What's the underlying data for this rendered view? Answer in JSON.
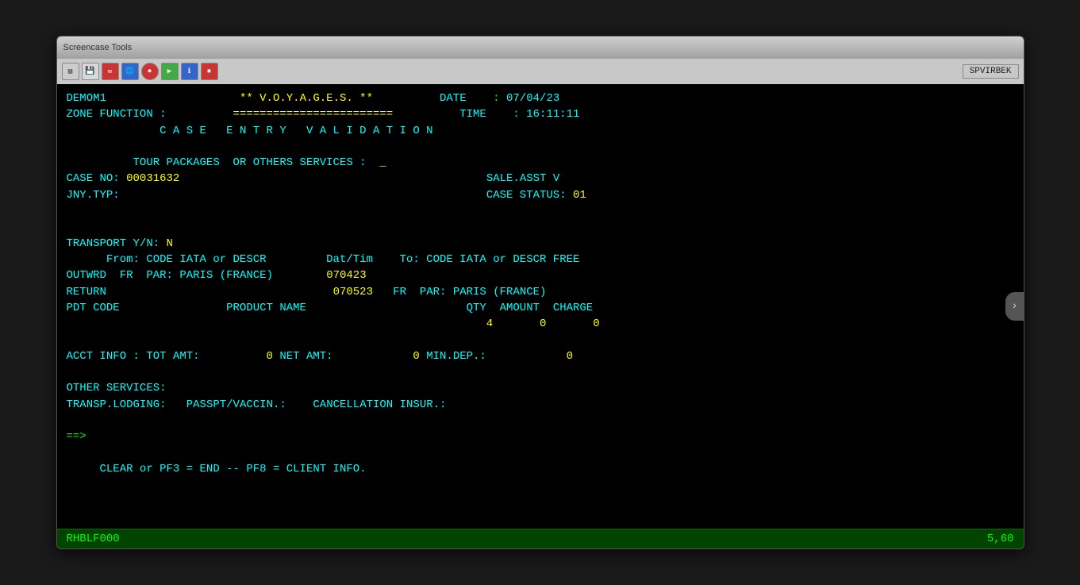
{
  "window": {
    "title_left": "Screencase  Tools",
    "corner_badge": "SPVIRBEK",
    "toolbar_icons": [
      "folder",
      "save",
      "email",
      "globe",
      "record",
      "play",
      "info",
      "stop"
    ]
  },
  "terminal": {
    "line1_left": "DEMOM1",
    "line1_center": "** V.O.Y.A.G.E.S. **",
    "line1_date_label": "DATE",
    "line1_date_value": "07/04/23",
    "line2_left": "ZONE FUNCTION :",
    "line2_center": "========================",
    "line2_time_label": "TIME",
    "line2_time_value": "16:11:11",
    "line3": "C A S E   E N T R Y   V A L I D A T I O N",
    "line4_blank": "",
    "line5": "TOUR PACKAGES  OR OTHERS SERVICES :",
    "line5_cursor": "_",
    "line6_left": "CASE NO: 00031632",
    "line6_right": "SALE.ASST V",
    "line7_left": "JNY.TYP:",
    "line7_right": "CASE STATUS: 01",
    "line8_blank": "",
    "line9_blank": "",
    "line10_left": "TRANSPORT Y/N: N",
    "line11": "      From: CODE IATA or DESCR         Dat/Tim    To: CODE IATA or DESCR FREE",
    "line12": "OUTWRD  FR  PAR: PARIS (FRANCE)        070423",
    "line13_left": "RETURN",
    "line13_mid": "070523",
    "line13_right": "FR  PAR: PARIS (FRANCE)",
    "line14": "PDT CODE                PRODUCT NAME                        QTY  AMOUNT  CHARGE",
    "line15": "                                                               4       0       0",
    "line16_blank": "",
    "line17": "ACCT INFO : TOT AMT:          0 NET AMT:            0 MIN.DEP.:            0",
    "line18_blank": "",
    "line19": "OTHER SERVICES:",
    "line20": "TRANSP.LODGING:   PASSPT/VACCIN.:    CANCELLATION INSUR.:",
    "line21_blank": "",
    "line22": "==>",
    "line23_blank": "",
    "line24": "     CLEAR or PF3 = END -- PF8 = CLIENT INFO.",
    "status_left": "RHBLF000",
    "status_right": "5,60"
  }
}
